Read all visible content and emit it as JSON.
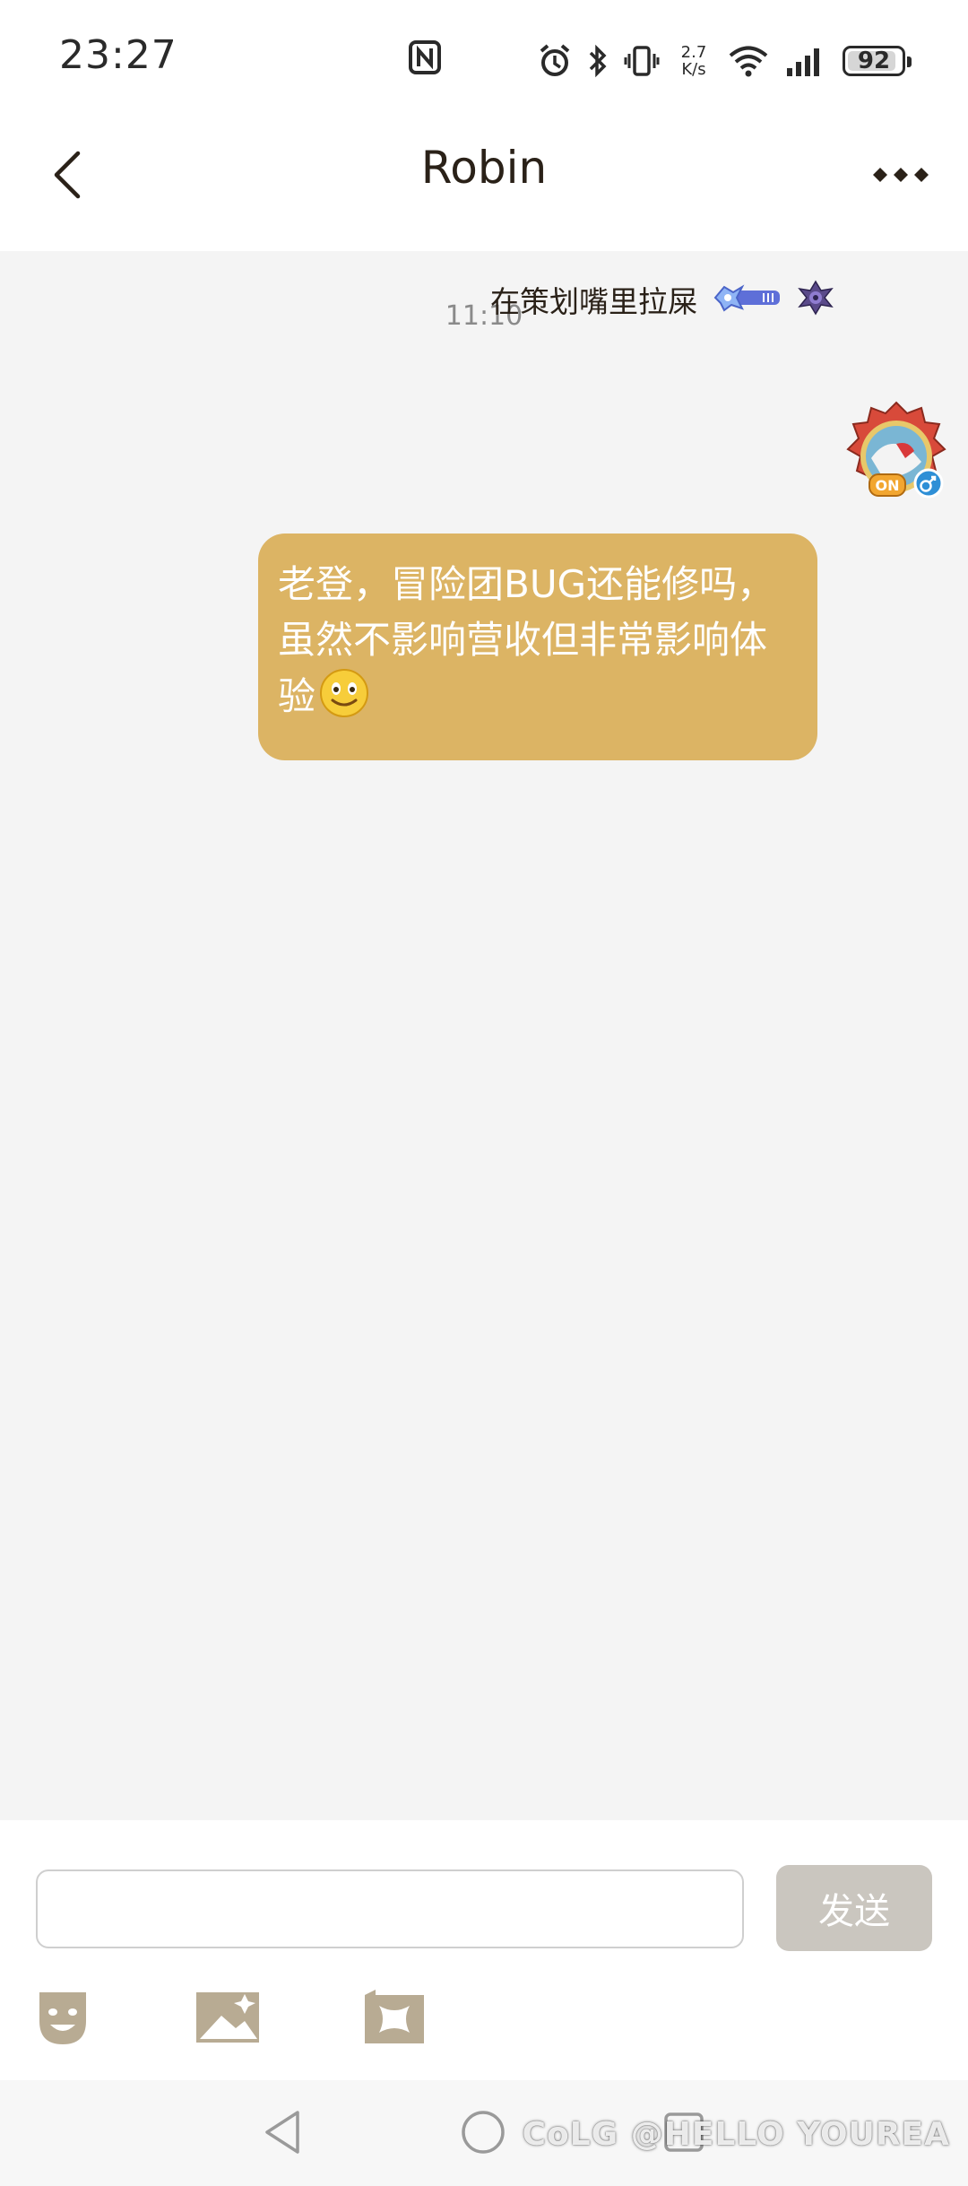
{
  "status_bar": {
    "time": "23:27",
    "net_speed_value": "2.7",
    "net_speed_unit": "K/s",
    "battery": "92",
    "battery_level_percent": 92
  },
  "header": {
    "title": "Robin"
  },
  "conversation": {
    "timestamp": "11:10",
    "messages": [
      {
        "sender_name": "在策划嘴里拉屎",
        "text": "老登，冒险团BUG还能修吗，虽然不影响营收但非常影响体验",
        "emoji": "smile-emoji"
      }
    ]
  },
  "composer": {
    "input_value": "",
    "send_label": "发送"
  },
  "watermark": "CoLG @HELLO YOUREA",
  "colors": {
    "bubble": "#dcb464",
    "chat_background": "#f4f4f4",
    "send_button": "#cac6bf",
    "tool_icons": "#b8ab93"
  }
}
